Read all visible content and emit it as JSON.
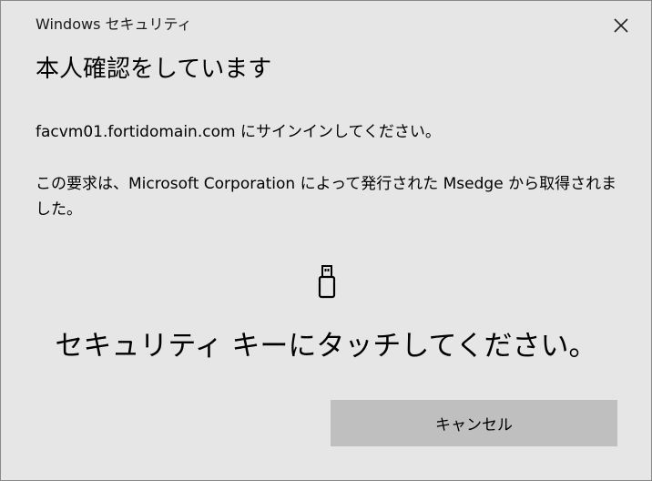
{
  "window": {
    "title": "Windows セキュリティ"
  },
  "dialog": {
    "heading": "本人確認をしています",
    "signin_text": "facvm01.fortidomain.com にサインインしてください。",
    "request_text": "この要求は、Microsoft Corporation によって発行された Msedge から取得されました。",
    "touch_prompt": "セキュリティ キーにタッチしてください。",
    "cancel_label": "キャンセル"
  },
  "icons": {
    "close": "close-icon",
    "key": "security-key-icon"
  },
  "colors": {
    "background": "#e6e6e6",
    "button": "#bfbfbf",
    "text": "#000000"
  }
}
